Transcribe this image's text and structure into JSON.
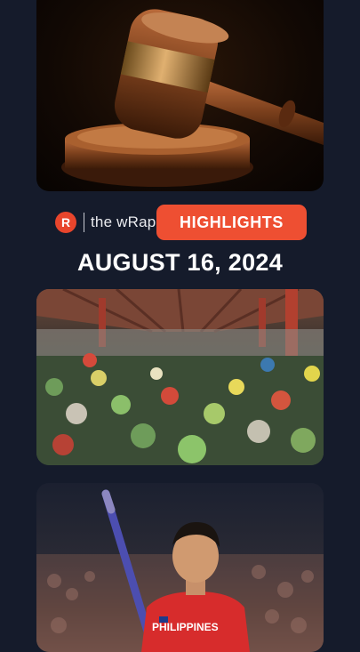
{
  "header": {
    "brand_mark": "R",
    "brand_name": "the wRap",
    "section_pill": "HIGHLIGHTS",
    "date": "AUGUST 16, 2024"
  },
  "images": {
    "top": "gavel-photo",
    "middle": "market-photo",
    "bottom": "pole-vault-athlete-photo"
  },
  "athlete": {
    "jersey_text": "PHILIPPINES"
  },
  "colors": {
    "background": "#151b2b",
    "accent": "#ee4f32",
    "logo": "#e8452c"
  }
}
